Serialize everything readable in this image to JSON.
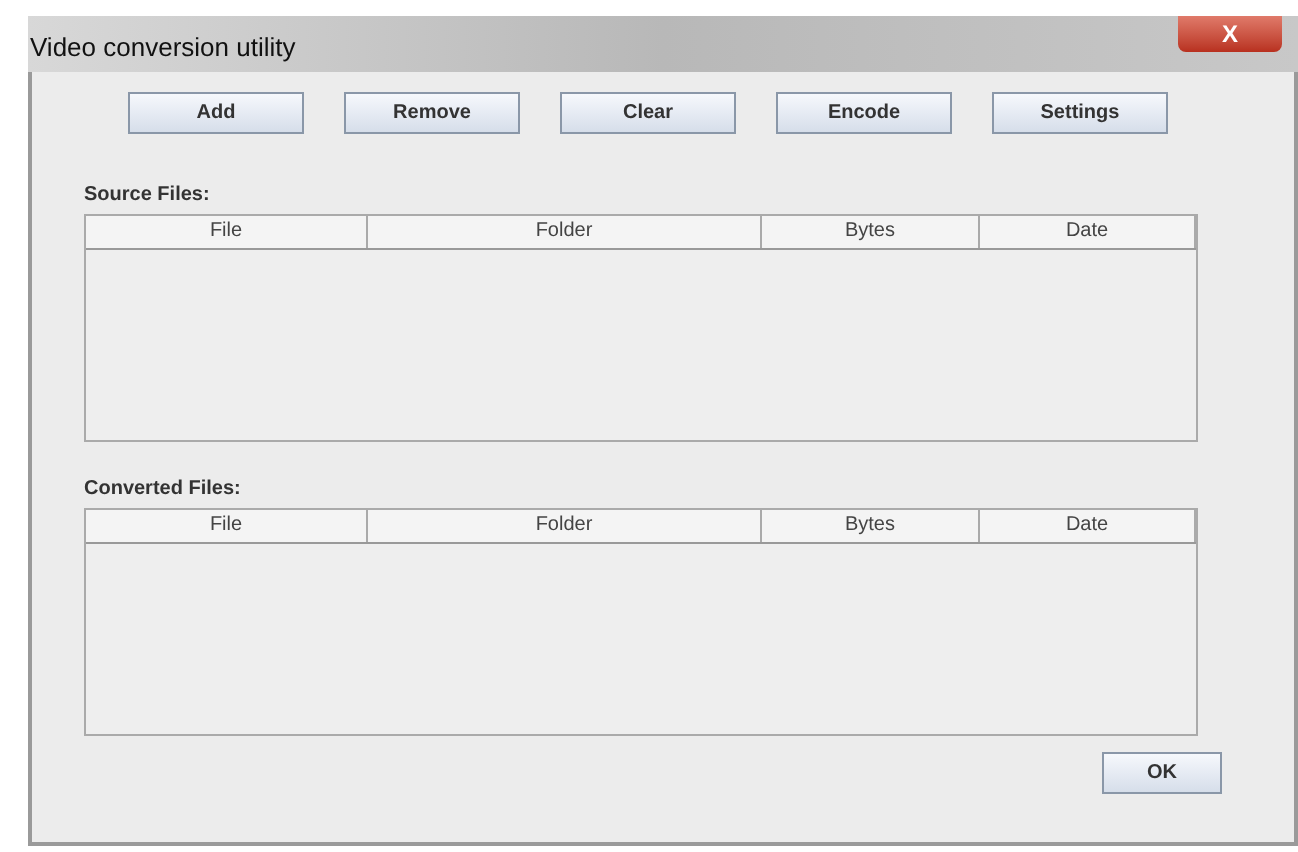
{
  "window": {
    "title": "Video conversion utility",
    "close": "X"
  },
  "toolbar": [
    "Add",
    "Remove",
    "Clear",
    "Encode",
    "Settings"
  ],
  "tables": [
    {
      "label": "Source Files:",
      "columns": [
        "File",
        "Folder",
        "Bytes",
        "Date"
      ]
    },
    {
      "label": "Converted Files:",
      "columns": [
        "File",
        "Folder",
        "Bytes",
        "Date"
      ]
    }
  ],
  "buttons": [
    "OK"
  ]
}
